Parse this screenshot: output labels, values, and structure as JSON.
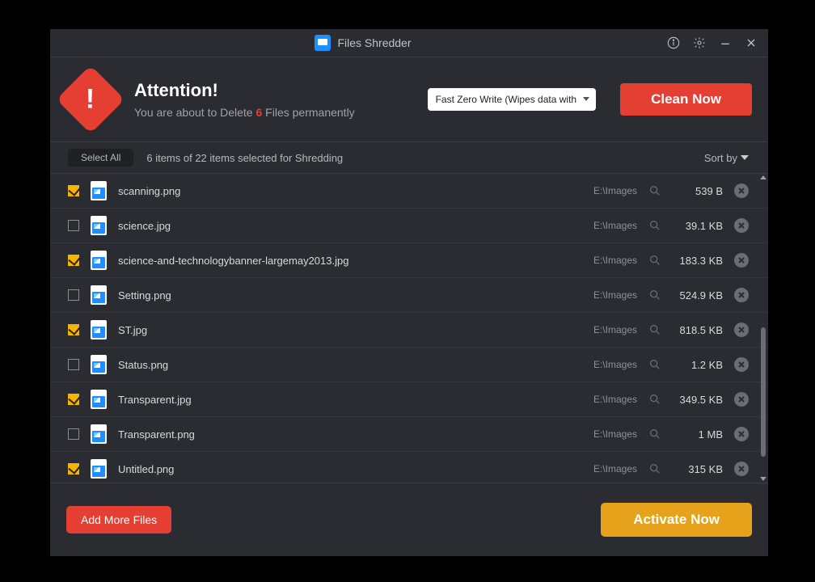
{
  "titlebar": {
    "app_name": "Files Shredder"
  },
  "banner": {
    "heading": "Attention!",
    "pre": "You are about to Delete ",
    "count": "6",
    "post": " Files permanently"
  },
  "method": {
    "selected": "Fast Zero Write (Wipes data with"
  },
  "clean_label": "Clean Now",
  "list_header": {
    "select_all": "Select All",
    "status": "6 items of 22 items selected for Shredding",
    "sort": "Sort by"
  },
  "files": [
    {
      "checked": true,
      "name": "scanning.png",
      "path": "E:\\Images",
      "size": "539 B"
    },
    {
      "checked": false,
      "name": "science.jpg",
      "path": "E:\\Images",
      "size": "39.1 KB"
    },
    {
      "checked": true,
      "name": "science-and-technologybanner-largemay2013.jpg",
      "path": "E:\\Images",
      "size": "183.3 KB"
    },
    {
      "checked": false,
      "name": "Setting.png",
      "path": "E:\\Images",
      "size": "524.9 KB"
    },
    {
      "checked": true,
      "name": "ST.jpg",
      "path": "E:\\Images",
      "size": "818.5 KB"
    },
    {
      "checked": false,
      "name": "Status.png",
      "path": "E:\\Images",
      "size": "1.2 KB"
    },
    {
      "checked": true,
      "name": "Transparent.jpg",
      "path": "E:\\Images",
      "size": "349.5 KB"
    },
    {
      "checked": false,
      "name": "Transparent.png",
      "path": "E:\\Images",
      "size": "1 MB"
    },
    {
      "checked": true,
      "name": "Untitled.png",
      "path": "E:\\Images",
      "size": "315 KB"
    }
  ],
  "footer": {
    "add": "Add More Files",
    "activate": "Activate Now"
  }
}
